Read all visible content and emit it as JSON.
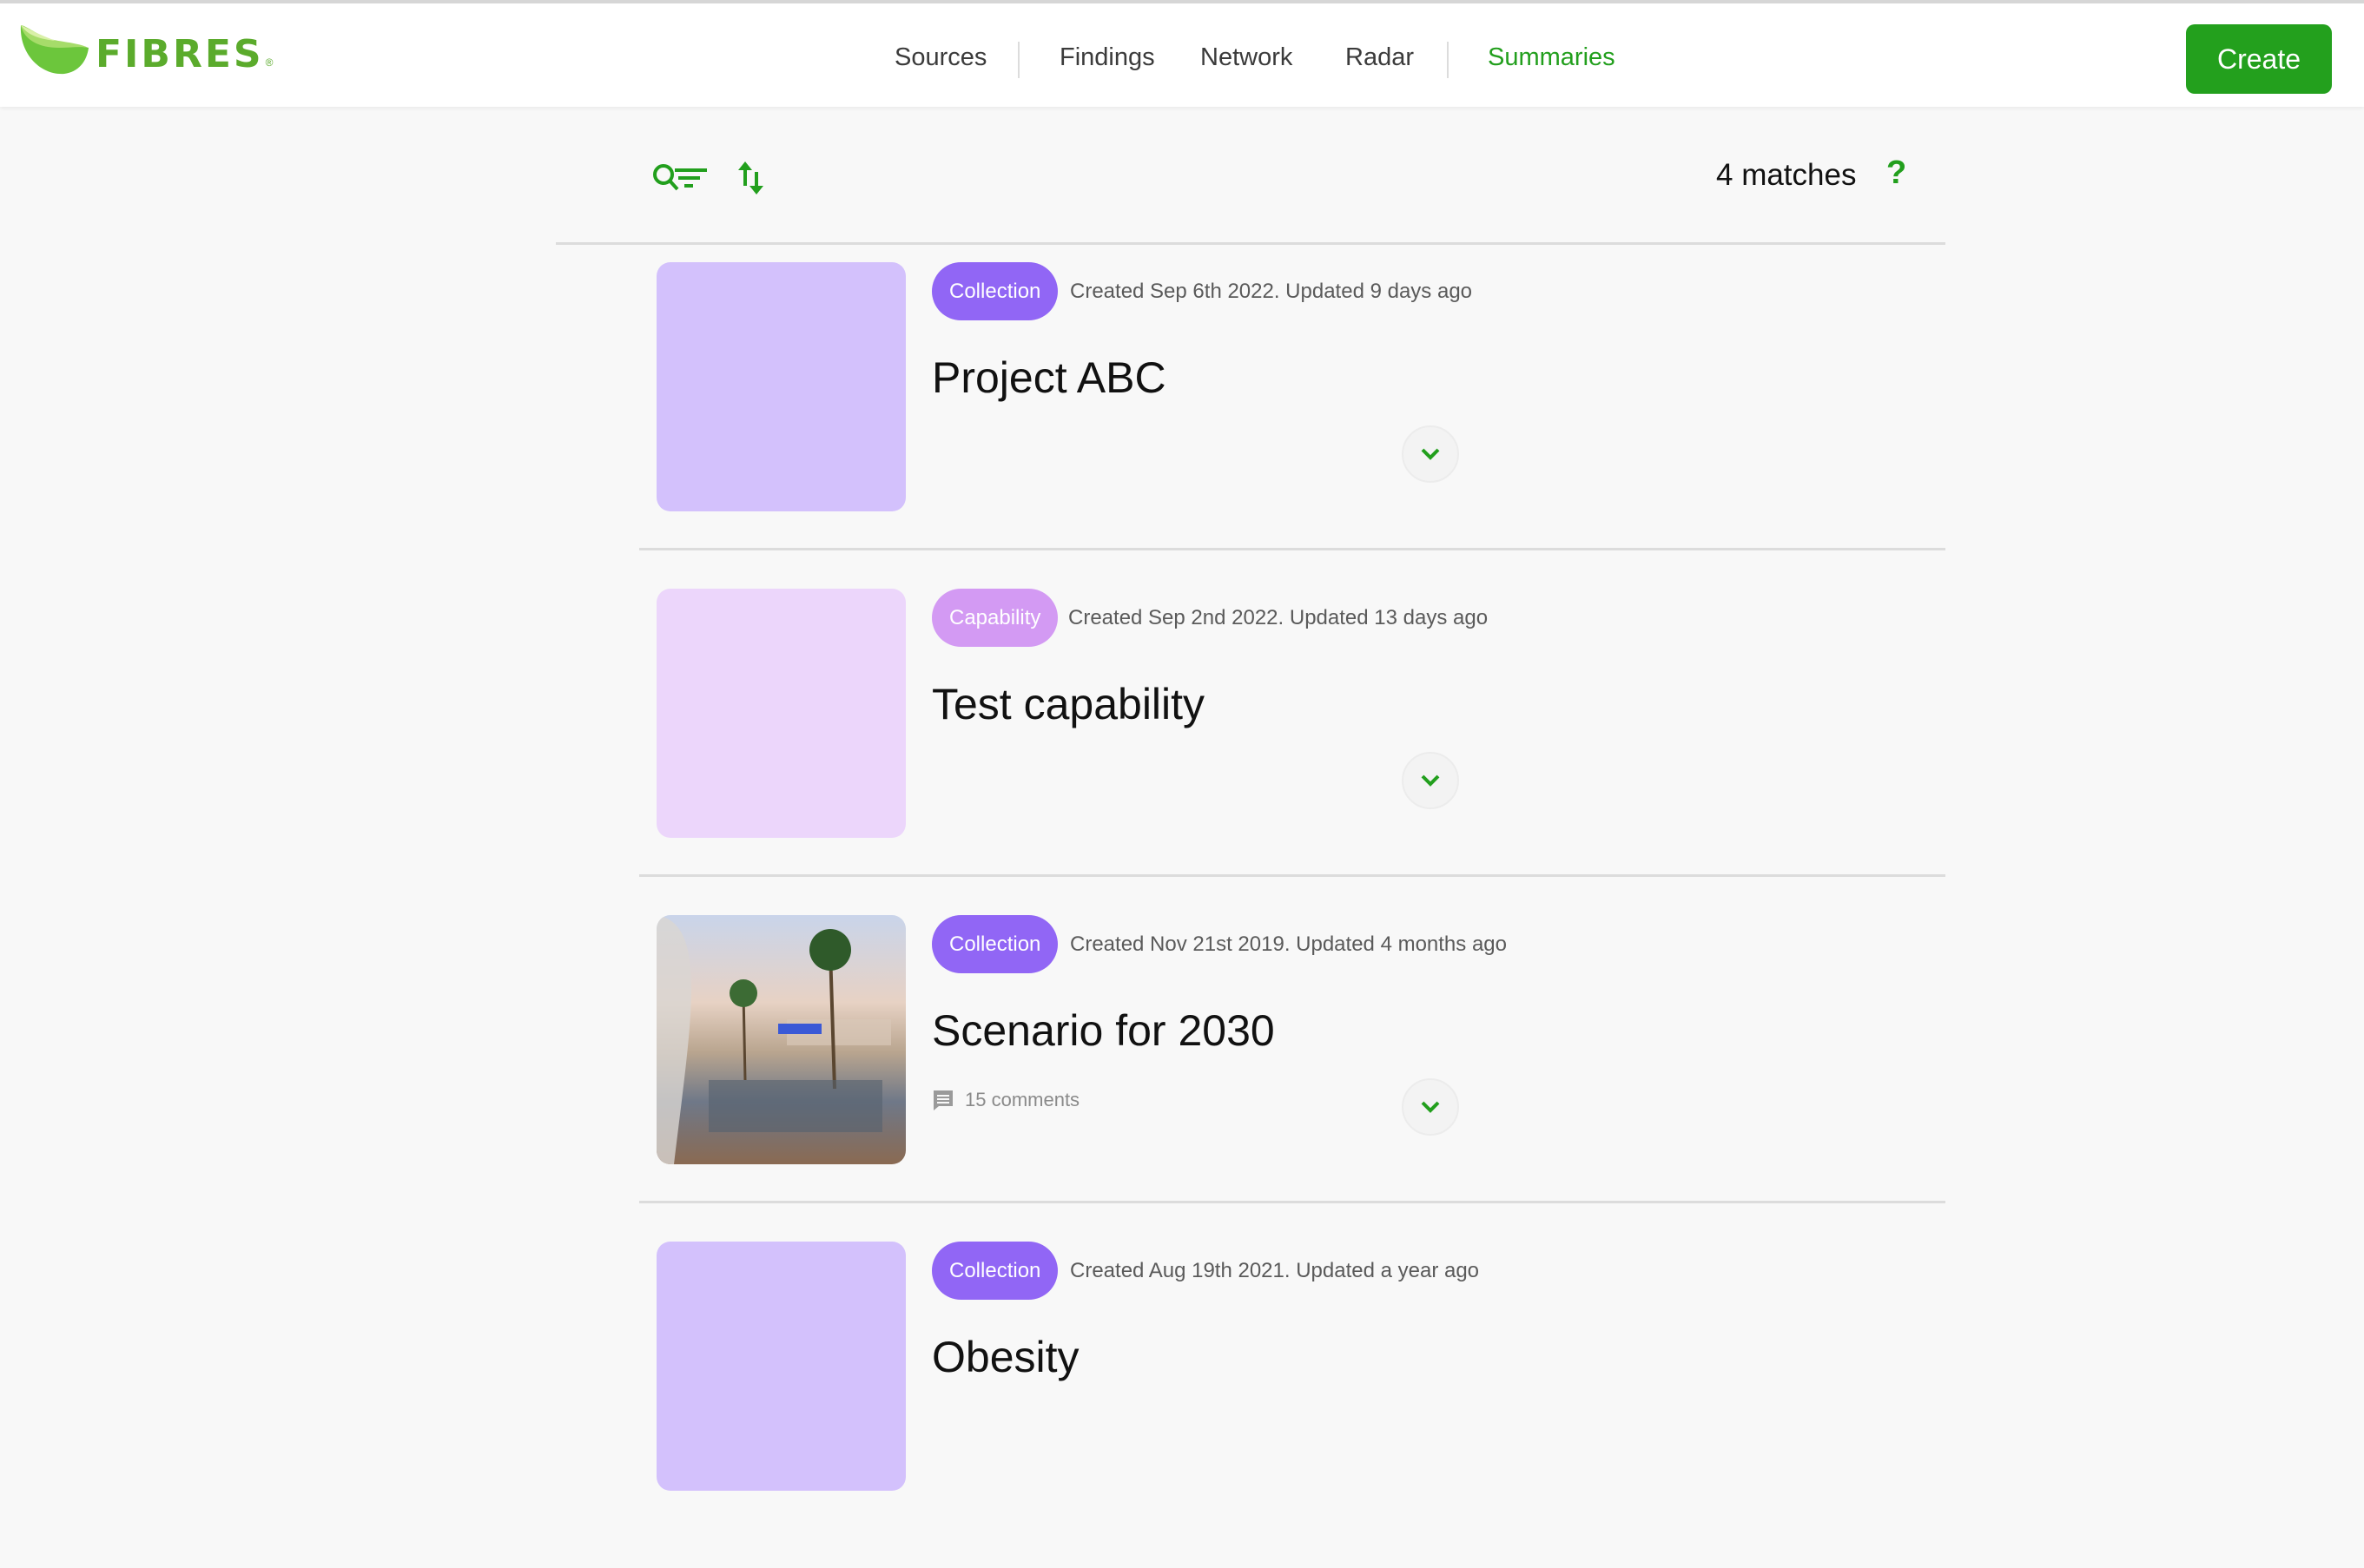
{
  "header": {
    "logo_text": "FIBRES",
    "logo_mark": "®",
    "nav": [
      {
        "label": "Sources",
        "active": false
      },
      {
        "label": "Findings",
        "active": false
      },
      {
        "label": "Network",
        "active": false
      },
      {
        "label": "Radar",
        "active": false
      },
      {
        "label": "Summaries",
        "active": true
      }
    ],
    "create_label": "Create"
  },
  "toolbar": {
    "filter_icon": "search-filter-icon",
    "sort_icon": "sort-arrows-icon",
    "matches_label": "4 matches",
    "help_label": "?"
  },
  "colors": {
    "accent": "#23a01d",
    "collection_badge": "#9166f5",
    "capability_badge": "#d39af3",
    "collection_thumb": "#d3c1fc",
    "capability_thumb": "#ecd6fb"
  },
  "items": [
    {
      "type": "Collection",
      "meta": "Created Sep 6th 2022. Updated 9 days ago",
      "title": "Project ABC",
      "thumbnail": "placeholder",
      "comments": null
    },
    {
      "type": "Capability",
      "meta": "Created Sep 2nd 2022. Updated 13 days ago",
      "title": "Test capability",
      "thumbnail": "placeholder",
      "comments": null
    },
    {
      "type": "Collection",
      "meta": "Created Nov 21st 2019. Updated 4 months ago",
      "title": "Scenario for 2030",
      "thumbnail": "city-scene-image",
      "comments": "15 comments"
    },
    {
      "type": "Collection",
      "meta": "Created Aug 19th 2021. Updated a year ago",
      "title": "Obesity",
      "thumbnail": "placeholder",
      "comments": null
    }
  ]
}
